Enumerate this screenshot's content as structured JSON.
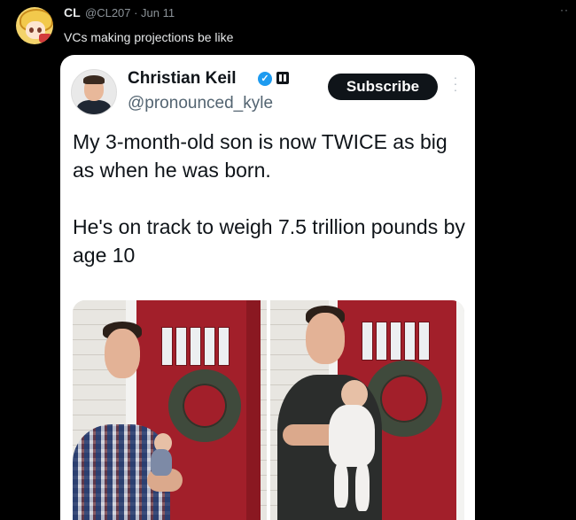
{
  "outer_tweet": {
    "author_name": "CL",
    "handle_date": "@CL207 · Jun 11",
    "text": "VCs making projections be like",
    "more_label": "··"
  },
  "embedded_post": {
    "author_name": "Christian Keil",
    "handle": "@pronounced_kyle",
    "subscribe_label": "Subscribe",
    "verified_icon": "✓",
    "paragraph_1": "My 3-month-old son is now TWICE as big as when he was born.",
    "paragraph_2": "He's on track to weigh 7.5 trillion pounds by age 10"
  },
  "colors": {
    "background": "#000000",
    "card": "#ffffff",
    "verified_blue": "#1d9bf0",
    "door_red": "#a21f2a"
  },
  "icons": [
    "anime-avatar-icon",
    "verified-badge-icon",
    "org-badge-icon",
    "more-options-icon"
  ]
}
